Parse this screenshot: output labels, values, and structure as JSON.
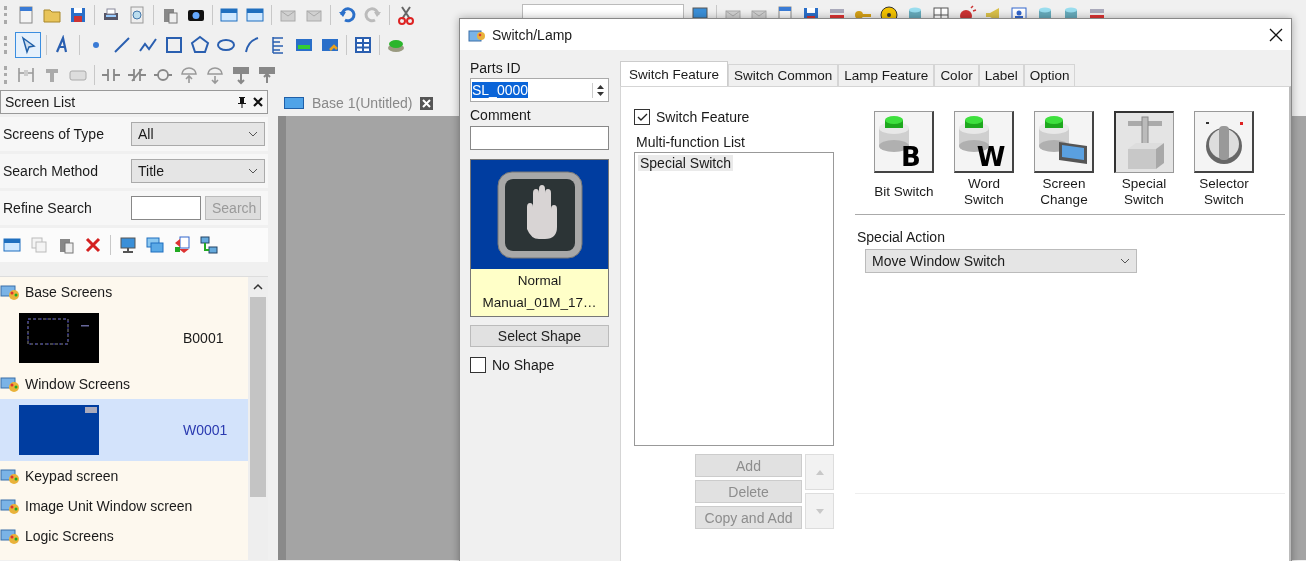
{
  "screen_list": {
    "title": "Screen List",
    "filters": [
      {
        "label": "Screens of Type",
        "value": "All"
      },
      {
        "label": "Search Method",
        "value": "Title"
      }
    ],
    "refine": {
      "label": "Refine Search",
      "button": "Search",
      "disabled": true
    },
    "tree": [
      {
        "label": "Base Screens",
        "children": [
          {
            "label": "B0001",
            "kind": "base",
            "selected": false
          }
        ]
      },
      {
        "label": "Window Screens",
        "children": [
          {
            "label": "W0001",
            "kind": "window",
            "selected": true
          }
        ]
      },
      {
        "label": "Keypad screen"
      },
      {
        "label": "Image Unit Window screen"
      },
      {
        "label": "Logic Screens"
      }
    ]
  },
  "document_tab": {
    "label": "Base 1(Untitled)"
  },
  "dialog": {
    "title": "Switch/Lamp",
    "parts_id": {
      "label": "Parts ID",
      "value": "SL_0000",
      "value_selected": true
    },
    "comment": {
      "label": "Comment"
    },
    "shape": {
      "state": "Normal",
      "name": "Manual_01M_17…"
    },
    "select_shape": "Select Shape",
    "no_shape": {
      "label": "No Shape",
      "checked": false
    },
    "tabs": [
      {
        "label": "Switch Feature",
        "selected": true
      },
      {
        "label": "Switch Common",
        "selected": false
      },
      {
        "label": "Lamp Feature",
        "selected": false
      },
      {
        "label": "Color",
        "selected": false
      },
      {
        "label": "Label",
        "selected": false
      },
      {
        "label": "Option",
        "selected": false
      }
    ],
    "switch_feature": {
      "label": "Switch Feature",
      "checked": true
    },
    "multi_function": {
      "label": "Multi-function List",
      "items": [
        {
          "label": "Special Switch",
          "selected": true
        }
      ]
    },
    "list_buttons": [
      {
        "label": "Add",
        "disabled": true
      },
      {
        "label": "Delete",
        "disabled": true
      },
      {
        "label": "Copy and Add",
        "disabled": true
      }
    ],
    "switch_types": [
      {
        "kind": "bit",
        "letter": "B",
        "label": "Bit Switch",
        "selected": false
      },
      {
        "kind": "word",
        "letter": "W",
        "label": "Word Switch",
        "selected": false
      },
      {
        "kind": "screen",
        "label": "Screen Change",
        "selected": false
      },
      {
        "kind": "special",
        "label": "Special Switch",
        "selected": true
      },
      {
        "kind": "selector",
        "label": "Selector Switch",
        "selected": false
      }
    ],
    "special_action": {
      "label": "Special Action",
      "value": "Move Window Switch"
    }
  }
}
